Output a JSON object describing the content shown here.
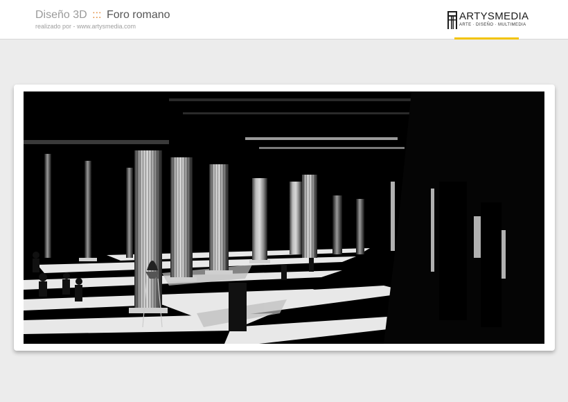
{
  "header": {
    "title_prefix": "Diseño 3D",
    "title_separator": ":::",
    "title_main": "Foro romano",
    "subtitle": "realizado por - www.artysmedia.com"
  },
  "logo": {
    "name": "ARTYSMEDIA",
    "tagline": "ARTE · DISEÑO · MULTIMEDIA",
    "accent_color": "#f2c300"
  },
  "artwork": {
    "alt": "Foro romano",
    "icon": "image-icon"
  },
  "colors": {
    "background": "#ececec",
    "header": "#ffffff",
    "separator_accent": "#e08a3a",
    "logo_underline": "#f2c300"
  }
}
